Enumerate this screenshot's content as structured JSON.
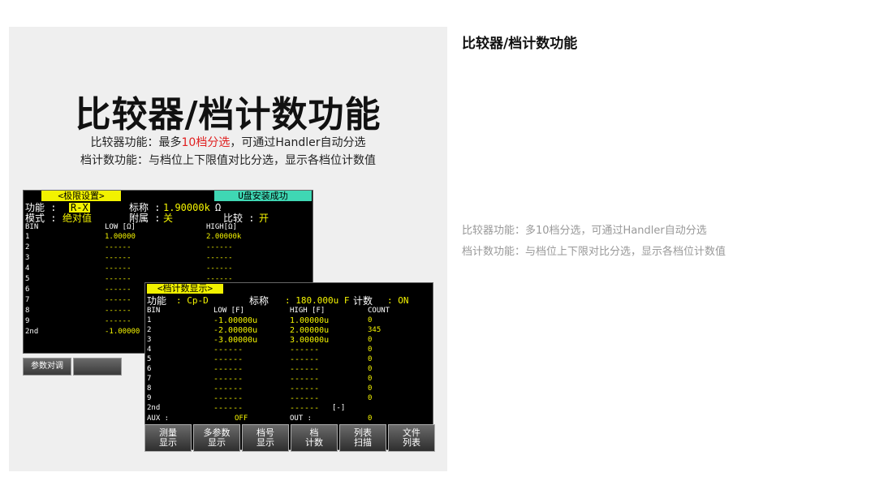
{
  "hero": {
    "title": "比较器/档计数功能",
    "line1_prefix": "比较器功能：最多",
    "line1_highlight": "10档分选",
    "line1_suffix": "，可通过Handler自动分选",
    "line2": "档计数功能：与档位上下限值对比分选，显示各档位计数值",
    "highlight_color": "#e02020"
  },
  "screen1": {
    "header": "<极限设置>",
    "usb_status": "U盘安装成功",
    "func_label": "功能 :",
    "func_value": "R-X",
    "nominal_label": "标称 :",
    "nominal_value": "1.90000k",
    "nominal_unit": "Ω",
    "mode_label": "模式 :",
    "mode_value": "绝对值",
    "aux_label": "附属 :",
    "aux_value": "关",
    "compare_label": "比较 :",
    "compare_value": "开",
    "col_bin": "BIN",
    "col_low": "LOW [Ω]",
    "col_high": "HIGH[Ω]",
    "rows": [
      {
        "bin": "1",
        "low": "1.00000",
        "high": "2.00000k"
      },
      {
        "bin": "2",
        "low": "------",
        "high": "------"
      },
      {
        "bin": "3",
        "low": "------",
        "high": "------"
      },
      {
        "bin": "4",
        "low": "------",
        "high": "------"
      },
      {
        "bin": "5",
        "low": "------",
        "high": "------"
      },
      {
        "bin": "6",
        "low": "------",
        "high": ""
      },
      {
        "bin": "7",
        "low": "------",
        "high": ""
      },
      {
        "bin": "8",
        "low": "------",
        "high": ""
      },
      {
        "bin": "9",
        "low": "------",
        "high": ""
      },
      {
        "bin": "2nd",
        "low": "-1.00000",
        "high": ""
      }
    ],
    "button1": "参数对调"
  },
  "screen2": {
    "header": "<档计数显示>",
    "func_label": "功能",
    "func_value": ": Cp-D",
    "nominal_label": "标称",
    "nominal_value": ": 180.000u F",
    "count_label": "计数",
    "count_value": ": ON",
    "col_bin": "BIN",
    "col_low": "LOW [F]",
    "col_high": "HIGH [F]",
    "col_count": "COUNT",
    "rows": [
      {
        "bin": "1",
        "low": "-1.00000u",
        "high": "1.00000u",
        "count": "0"
      },
      {
        "bin": "2",
        "low": "-2.00000u",
        "high": "2.00000u",
        "count": "345"
      },
      {
        "bin": "3",
        "low": "-3.00000u",
        "high": "3.00000u",
        "count": "0"
      },
      {
        "bin": "4",
        "low": "------",
        "high": "------",
        "count": "0"
      },
      {
        "bin": "5",
        "low": "------",
        "high": "------",
        "count": "0"
      },
      {
        "bin": "6",
        "low": "------",
        "high": "------",
        "count": "0"
      },
      {
        "bin": "7",
        "low": "------",
        "high": "------",
        "count": "0"
      },
      {
        "bin": "8",
        "low": "------",
        "high": "------",
        "count": "0"
      },
      {
        "bin": "9",
        "low": "------",
        "high": "------",
        "count": "0"
      },
      {
        "bin": "2nd",
        "low": "------",
        "high": "------",
        "count": "[-]"
      }
    ],
    "aux_label": "AUX :",
    "aux_value": "OFF",
    "out_label": "OUT :",
    "out_value": "0",
    "buttons": [
      {
        "l1": "测量",
        "l2": "显示"
      },
      {
        "l1": "多参数",
        "l2": "显示"
      },
      {
        "l1": "档号",
        "l2": "显示"
      },
      {
        "l1": "档",
        "l2": "计数"
      },
      {
        "l1": "列表",
        "l2": "扫描"
      },
      {
        "l1": "文件",
        "l2": "列表"
      }
    ]
  },
  "side": {
    "title": "比较器/档计数功能",
    "line1": "比较器功能：多10档分选，可通过Handler自动分选",
    "line2": "档计数功能：与档位上下限对比分选，显示各档位计数值"
  }
}
